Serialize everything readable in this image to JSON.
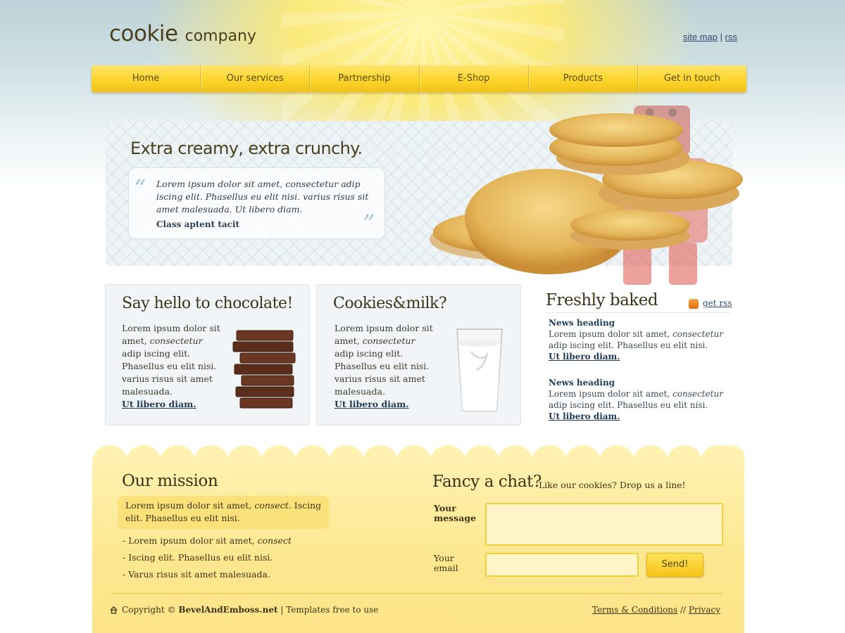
{
  "header": {
    "logo_primary": "cookie",
    "logo_secondary": "company",
    "links": {
      "site_map": "site map",
      "separator": "|",
      "rss": "rss"
    }
  },
  "nav": {
    "items": [
      {
        "label": "Home"
      },
      {
        "label": "Our services"
      },
      {
        "label": "Partnership"
      },
      {
        "label": "E-Shop"
      },
      {
        "label": "Products"
      },
      {
        "label": "Get in touch"
      }
    ]
  },
  "hero": {
    "title": "Extra creamy, extra crunchy.",
    "quote": "Lorem ipsum dolor sit amet, consectetur adip iscing elit. Phasellus eu elit nisi. varius risus sit amet malesuada. Ut libero diam.",
    "author": "Class aptent tacit",
    "quote_open": "“",
    "quote_close": "”"
  },
  "boxes": [
    {
      "title": "Say hello to chocolate!",
      "text_a": "Lorem ipsum dolor sit amet, ",
      "text_em": "consectetur",
      "text_b": " adip iscing elit. Phasellus eu elit nisi. varius risus sit amet malesuada.",
      "link": "Ut libero diam."
    },
    {
      "title": "Cookies&milk?",
      "text_a": "Lorem ipsum dolor sit amet, ",
      "text_em": "consectetur",
      "text_b": " adip iscing elit. Phasellus eu elit nisi. varius risus sit amet malesuada.",
      "link": "Ut libero diam."
    }
  ],
  "fresh": {
    "title": "Freshly baked",
    "get_rss": "get rss",
    "news": [
      {
        "heading": "News heading",
        "text_a": "Lorem ipsum dolor sit amet, ",
        "text_em": "consectetur",
        "text_b": " adip iscing elit. Phasellus eu elit nisi.",
        "link": "Ut libero diam."
      },
      {
        "heading": "News heading",
        "text_a": "Lorem ipsum dolor sit amet, ",
        "text_em": "consectetur",
        "text_b": " adip iscing elit. Phasellus eu elit nisi.",
        "link": "Ut libero diam."
      }
    ]
  },
  "mission": {
    "title": "Our mission",
    "highlight_a": "Lorem ipsum dolor sit amet, ",
    "highlight_em": "consect",
    "highlight_b": ". Iscing elit. Phasellus eu elit nisi.",
    "list": [
      {
        "a": "- Lorem ipsum dolor sit amet, ",
        "em": "consect"
      },
      {
        "a": "- Iscing elit. Phasellus eu elit nisi.",
        "em": ""
      },
      {
        "a": "- Varus risus sit amet malesuada.",
        "em": ""
      }
    ]
  },
  "chat": {
    "title": "Fancy a chat?",
    "subtitle": "Like our cookies? Drop us a line!",
    "message_label_1": "Your",
    "message_label_2": "message",
    "email_label_1": "Your",
    "email_label_2": "email",
    "message_value": "",
    "email_value": "",
    "send": "Send!"
  },
  "footer": {
    "copyright_prefix": "Copyright © ",
    "brand": "BevelAndEmboss.net",
    "copyright_suffix": " | Templates free to use",
    "terms": "Terms & Conditions",
    "sep": " // ",
    "privacy": "Privacy"
  },
  "colors": {
    "accent": "#fcd52b",
    "link": "#1e3a55"
  },
  "icons": [
    "quote-icon",
    "rss-icon",
    "home-icon"
  ]
}
